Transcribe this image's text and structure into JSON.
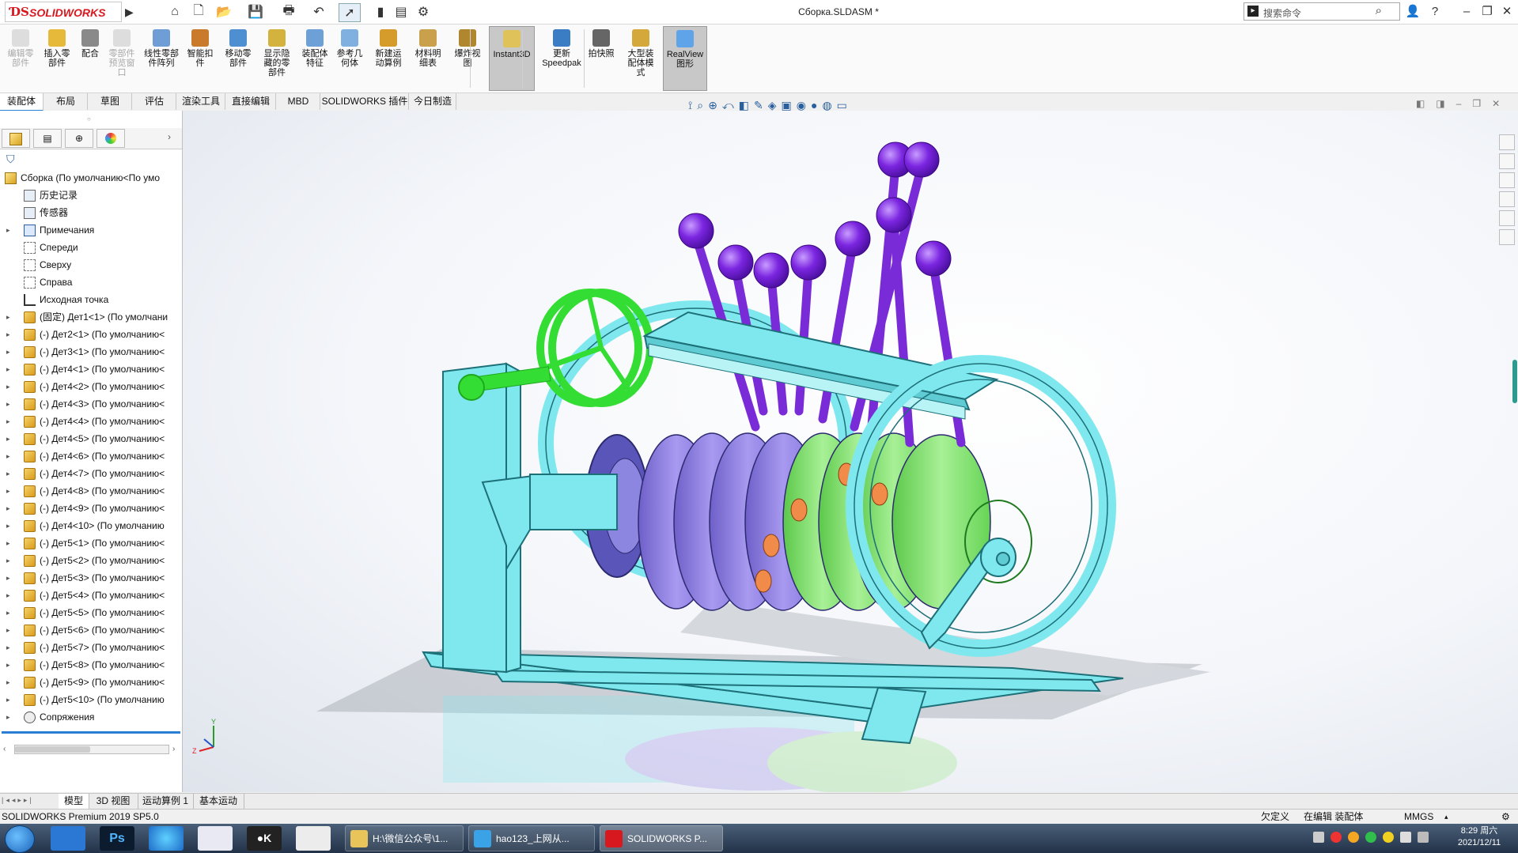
{
  "app": {
    "brand": "SOLIDWORKS",
    "document_title": "Сборка.SLDASM *",
    "search_placeholder": "搜索命令"
  },
  "quick_access": [
    {
      "name": "home-icon",
      "glyph": "⌂"
    },
    {
      "name": "new-document-icon",
      "glyph": "🗋"
    },
    {
      "name": "open-folder-icon",
      "glyph": "📂"
    },
    {
      "name": "save-icon",
      "glyph": "💾"
    },
    {
      "name": "print-icon",
      "glyph": "🖶"
    },
    {
      "name": "undo-icon",
      "glyph": "↶"
    },
    {
      "name": "select-pointer-icon",
      "glyph": "➚"
    },
    {
      "name": "traffic-light-icon",
      "glyph": "▮"
    },
    {
      "name": "file-properties-icon",
      "glyph": "▤"
    },
    {
      "name": "options-gear-icon",
      "glyph": "⚙"
    }
  ],
  "ribbon": {
    "buttons": [
      {
        "label": "编辑零\n部件",
        "disabled": true
      },
      {
        "label": "插入零\n部件"
      },
      {
        "label": "配合"
      },
      {
        "label": "零部件\n预览窗\n口",
        "disabled": true
      },
      {
        "label": "线性零部\n件阵列"
      },
      {
        "label": "智能扣\n件"
      },
      {
        "label": "移动零\n部件"
      },
      {
        "label": "显示隐\n藏的零\n部件"
      },
      {
        "label": "装配体\n特征"
      },
      {
        "label": "参考几\n何体"
      },
      {
        "label": "新建运\n动算例"
      },
      {
        "label": "材料明\n细表"
      },
      {
        "label": "爆炸视\n图"
      },
      {
        "label": "Instant3D",
        "active": true
      },
      {
        "label": "更新\nSpeedpak"
      },
      {
        "label": "拍快照"
      },
      {
        "label": "大型装\n配体模\n式"
      },
      {
        "label": "RealView\n图形",
        "active": true
      }
    ]
  },
  "command_tabs": [
    "装配体",
    "布局",
    "草图",
    "评估",
    "渲染工具",
    "直接编辑",
    "MBD",
    "SOLIDWORKS 插件",
    "今日制造"
  ],
  "tree": {
    "root": "Сборка  (По умолчанию<По умо",
    "items": [
      {
        "label": "历史记录",
        "icon": "history-icon",
        "expand": false
      },
      {
        "label": "传感器",
        "icon": "sensor-icon",
        "expand": false
      },
      {
        "label": "Примечания",
        "icon": "annotations-icon",
        "expand": true
      },
      {
        "label": "Спереди",
        "icon": "plane-icon",
        "expand": false
      },
      {
        "label": "Сверху",
        "icon": "plane-icon",
        "expand": false
      },
      {
        "label": "Справа",
        "icon": "plane-icon",
        "expand": false
      },
      {
        "label": "Исходная точка",
        "icon": "origin-icon",
        "expand": false
      },
      {
        "label": "(固定) Дет1<1> (По умолчани",
        "icon": "part-icon",
        "expand": true
      },
      {
        "label": "(-) Дет2<1> (По умолчанию<",
        "icon": "part-icon",
        "expand": true
      },
      {
        "label": "(-) Дет3<1> (По умолчанию<",
        "icon": "part-icon",
        "expand": true
      },
      {
        "label": "(-) Дет4<1> (По умолчанию<",
        "icon": "part-icon",
        "expand": true
      },
      {
        "label": "(-) Дет4<2> (По умолчанию<",
        "icon": "part-icon",
        "expand": true
      },
      {
        "label": "(-) Дет4<3> (По умолчанию<",
        "icon": "part-icon",
        "expand": true
      },
      {
        "label": "(-) Дет4<4> (По умолчанию<",
        "icon": "part-icon",
        "expand": true
      },
      {
        "label": "(-) Дет4<5> (По умолчанию<",
        "icon": "part-icon",
        "expand": true
      },
      {
        "label": "(-) Дет4<6> (По умолчанию<",
        "icon": "part-icon",
        "expand": true
      },
      {
        "label": "(-) Дет4<7> (По умолчанию<",
        "icon": "part-icon",
        "expand": true
      },
      {
        "label": "(-) Дет4<8> (По умолчанию<",
        "icon": "part-icon",
        "expand": true
      },
      {
        "label": "(-) Дет4<9> (По умолчанию<",
        "icon": "part-icon",
        "expand": true
      },
      {
        "label": "(-) Дет4<10> (По умолчанию",
        "icon": "part-icon",
        "expand": true
      },
      {
        "label": "(-) Дет5<1> (По умолчанию<",
        "icon": "part-icon",
        "expand": true
      },
      {
        "label": "(-) Дет5<2> (По умолчанию<",
        "icon": "part-icon",
        "expand": true
      },
      {
        "label": "(-) Дет5<3> (По умолчанию<",
        "icon": "part-icon",
        "expand": true
      },
      {
        "label": "(-) Дет5<4> (По умолчанию<",
        "icon": "part-icon",
        "expand": true
      },
      {
        "label": "(-) Дет5<5> (По умолчанию<",
        "icon": "part-icon",
        "expand": true
      },
      {
        "label": "(-) Дет5<6> (По умолчанию<",
        "icon": "part-icon",
        "expand": true
      },
      {
        "label": "(-) Дет5<7> (По умолчанию<",
        "icon": "part-icon",
        "expand": true
      },
      {
        "label": "(-) Дет5<8> (По умолчанию<",
        "icon": "part-icon",
        "expand": true
      },
      {
        "label": "(-) Дет5<9> (По умолчанию<",
        "icon": "part-icon",
        "expand": true
      },
      {
        "label": "(-) Дет5<10> (По умолчанию",
        "icon": "part-icon",
        "expand": true
      },
      {
        "label": "Сопряжения",
        "icon": "mates-icon",
        "expand": true
      }
    ]
  },
  "bottom_tabs": [
    "模型",
    "3D 视图",
    "运动算例 1",
    "基本运动"
  ],
  "status": {
    "product": "SOLIDWORKS Premium 2019 SP5.0",
    "defined": "欠定义",
    "mode": "在编辑 装配体",
    "units": "MMGS"
  },
  "taskbar": {
    "windows": [
      {
        "label": "H:\\微信公众号\\1...",
        "icon": "folder-icon",
        "color": "#e8c45a"
      },
      {
        "label": "hao123_上网从...",
        "icon": "browser-icon",
        "color": "#3aa3e8"
      },
      {
        "label": "SOLIDWORKS P...",
        "icon": "solidworks-icon",
        "color": "#d8181f"
      }
    ],
    "time": "8:29 周六",
    "date": "2021/12/11"
  },
  "colors": {
    "frame": "#7fe8ee",
    "frame_edge": "#1d6f78",
    "lever": "#7a2bd8",
    "knob": "#7b25e0",
    "disc_purple": "#9b8ce8",
    "disc_green": "#8fe57a",
    "handwheel": "#33dd33"
  }
}
